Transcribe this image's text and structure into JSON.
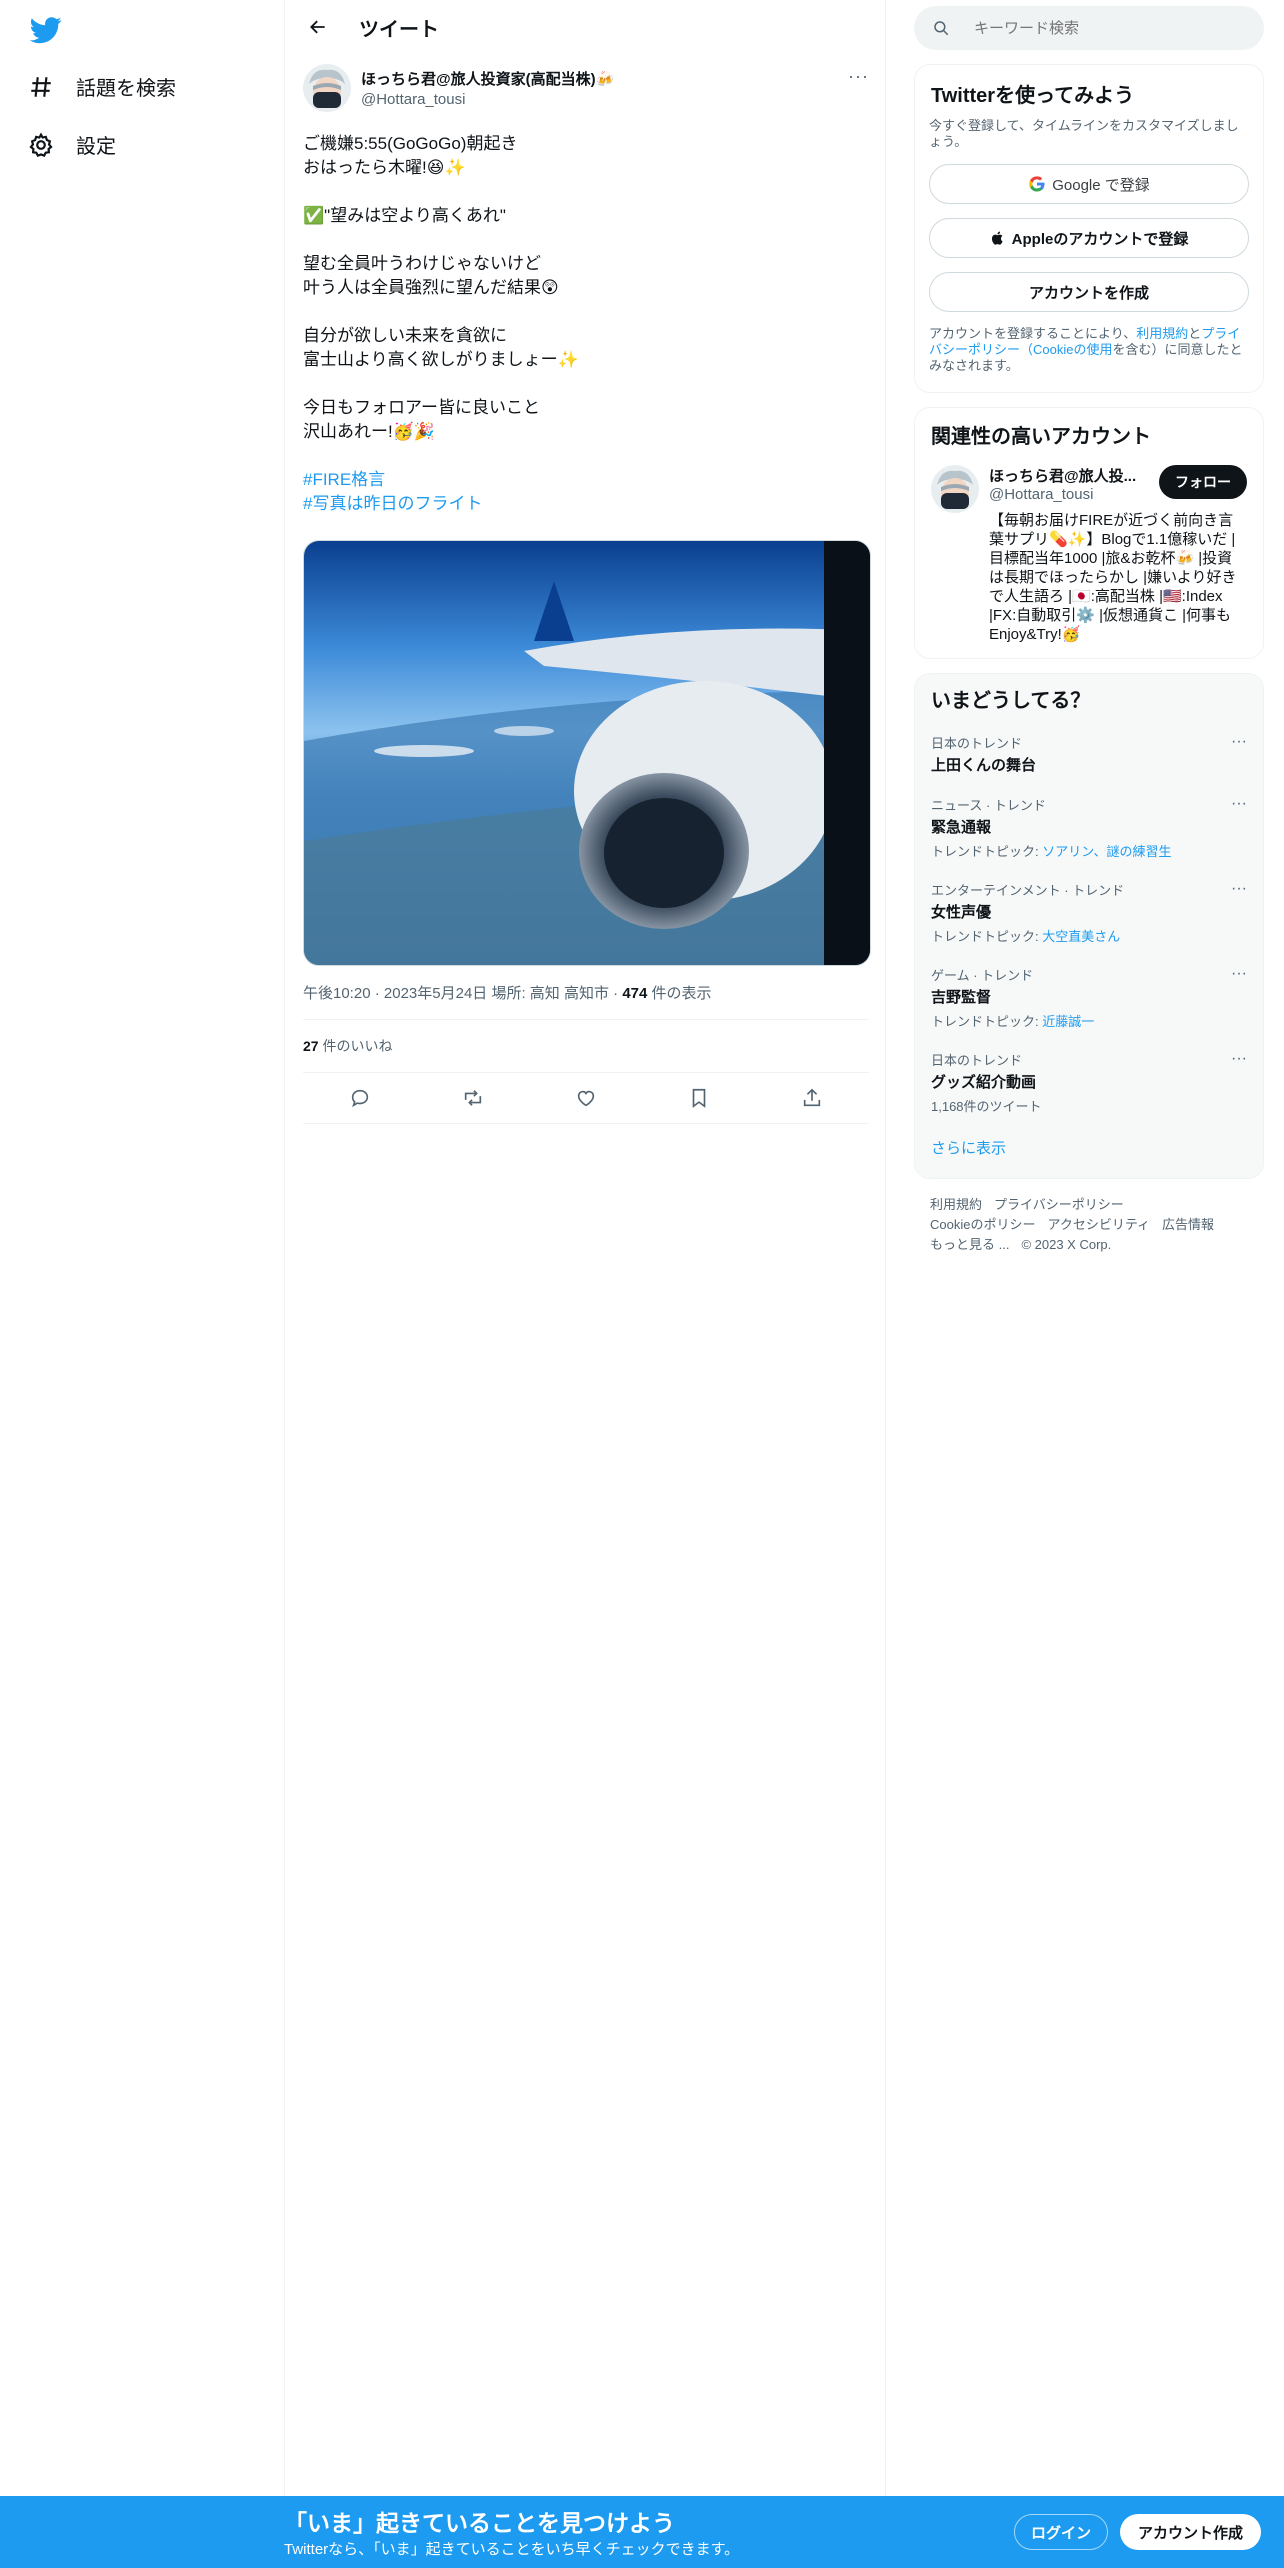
{
  "nav": {
    "explore_label": "話題を検索",
    "settings_label": "設定"
  },
  "header": {
    "title": "ツイート"
  },
  "tweet": {
    "author_name": "ほっちら君@旅人投資家(高配当株)🍻",
    "author_handle": "@Hottara_tousi",
    "more": "···",
    "paragraphs": [
      [
        "ご機嫌5:55(GoGoGo)朝起き",
        "おはったら木曜!😆✨"
      ],
      [
        "✅\"望みは空より高くあれ\""
      ],
      [
        "望む全員叶うわけじゃないけど",
        "叶う人は全員強烈に望んだ結果😲"
      ],
      [
        "自分が欲しい未来を貪欲に",
        "富士山より高く欲しがりましょー✨"
      ],
      [
        "今日もフォロアー皆に良いこと",
        "沢山あれー!🥳🎉"
      ]
    ],
    "hashtags": [
      "#FIRE格言",
      "#写真は昨日のフライト"
    ],
    "time": "午後10:20",
    "date": "2023年5月24日",
    "location": "場所: 高知 高知市",
    "views_count": "474",
    "views_label": "件の表示",
    "likes_count": "27",
    "likes_label": "件のいいね"
  },
  "search": {
    "placeholder": "キーワード検索"
  },
  "signup": {
    "title": "Twitterを使ってみよう",
    "desc": "今すぐ登録して、タイムラインをカスタマイズしましょう。",
    "google": "Google で登録",
    "apple": "Appleのアカウントで登録",
    "create": "アカウントを作成",
    "terms_prefix": "アカウントを登録することにより、",
    "terms_link": "利用規約",
    "terms_and": "と",
    "privacy_link": "プライバシーポリシー",
    "cookie_link": "（Cookieの使用",
    "terms_suffix": "を含む）に同意したとみなされます。"
  },
  "related": {
    "title": "関連性の高いアカウント",
    "name": "ほっちら君@旅人投...",
    "handle": "@Hottara_tousi",
    "follow": "フォロー",
    "bio": "【毎朝お届けFIREが近づく前向き言葉サプリ💊✨】Blogで1.1億稼いだ |目標配当年1000 |旅&お乾杯🍻 |投資は長期でほったらかし |嫌いより好きで人生語ろ |🇯🇵:高配当株 |🇺🇸:Index |FX:自動取引⚙️ |仮想通貨こ |何事もEnjoy&Try!🥳"
  },
  "trends": {
    "title": "いまどうしてる？",
    "items": [
      {
        "category": "日本のトレンド",
        "name": "上田くんの舞台",
        "sub_prefix": "",
        "sub_link": ""
      },
      {
        "category": "ニュース · トレンド",
        "name": "緊急通報",
        "sub_prefix": "トレンドトピック: ",
        "sub_link": "ソアリン、謎の練習生"
      },
      {
        "category": "エンターテインメント · トレンド",
        "name": "女性声優",
        "sub_prefix": "トレンドトピック: ",
        "sub_link": "大空直美さん"
      },
      {
        "category": "ゲーム · トレンド",
        "name": "吉野監督",
        "sub_prefix": "トレンドトピック: ",
        "sub_link": "近藤誠一"
      },
      {
        "category": "日本のトレンド",
        "name": "グッズ紹介動画",
        "sub_prefix": "1,168件のツイート",
        "sub_link": ""
      }
    ],
    "show_more": "さらに表示"
  },
  "footer": {
    "links": [
      "利用規約",
      "プライバシーポリシー",
      "Cookieのポリシー",
      "アクセシビリティ",
      "広告情報",
      "もっと見る ..."
    ],
    "copyright": "© 2023 X Corp."
  },
  "bottombar": {
    "title": "「いま」起きていることを見つけよう",
    "subtitle": "Twitterなら、「いま」起きていることをいち早くチェックできます。",
    "login": "ログイン",
    "signup": "アカウント作成"
  },
  "colors": {
    "accent": "#1d9bf0",
    "text": "#0f1419",
    "muted": "#536471"
  }
}
